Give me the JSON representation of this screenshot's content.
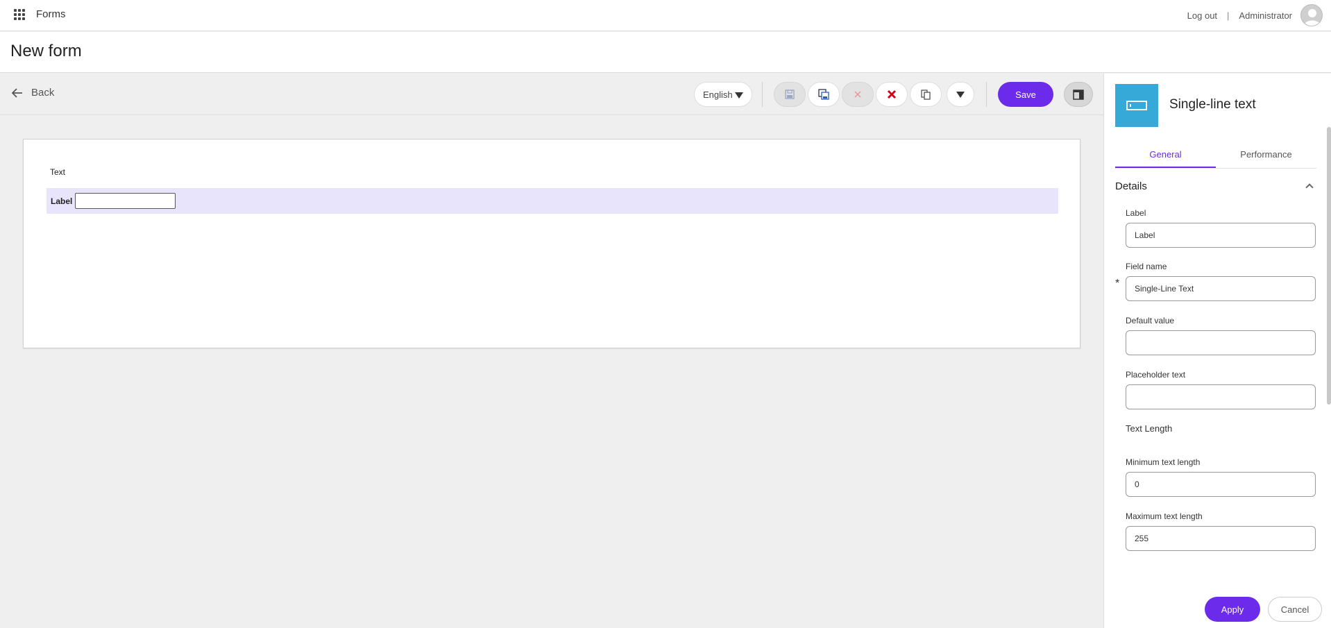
{
  "topbar": {
    "app_title": "Forms",
    "logout_label": "Log out",
    "separator": "|",
    "user_name": "Administrator"
  },
  "page": {
    "title": "New form"
  },
  "toolbar": {
    "back_label": "Back",
    "language": "English",
    "save_label": "Save"
  },
  "canvas": {
    "section_text": "Text",
    "field_label": "Label"
  },
  "panel": {
    "component_title": "Single-line text",
    "tabs": [
      {
        "label": "General",
        "active": true
      },
      {
        "label": "Performance",
        "active": false
      }
    ],
    "details_title": "Details",
    "fields": {
      "label": {
        "label": "Label",
        "value": "Label"
      },
      "field_name": {
        "label": "Field name",
        "value": "Single-Line Text",
        "required_mark": "*"
      },
      "default_value": {
        "label": "Default value",
        "value": ""
      },
      "placeholder_text": {
        "label": "Placeholder text",
        "value": ""
      },
      "text_length_heading": "Text Length",
      "min_length": {
        "label": "Minimum text length",
        "value": "0"
      },
      "max_length": {
        "label": "Maximum text length",
        "value": "255"
      }
    },
    "apply_label": "Apply",
    "cancel_label": "Cancel"
  },
  "colors": {
    "accent": "#6c2bea",
    "component_tile": "#36a9d9",
    "selected_row": "#e8e4fb",
    "delete_icon": "#d0021b"
  },
  "icons": [
    "apps-grid-icon",
    "user-avatar-icon",
    "arrow-left-icon",
    "caret-down-icon",
    "save-icon",
    "save-as-icon",
    "discard-icon",
    "delete-icon",
    "copy-icon",
    "more-options-icon",
    "panel-layout-icon",
    "single-line-text-icon",
    "chevron-up-icon"
  ]
}
